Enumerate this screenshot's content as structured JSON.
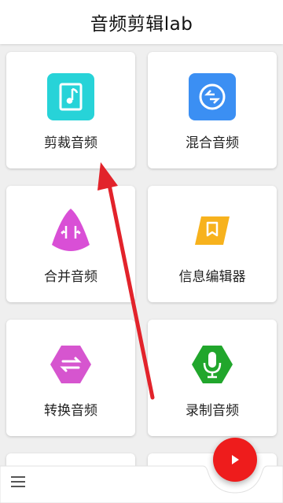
{
  "header": {
    "title": "音频剪辑lab"
  },
  "cards": [
    {
      "label": "剪裁音频",
      "icon": "music-file-icon",
      "color": "#27d3d8"
    },
    {
      "label": "混合音频",
      "icon": "mix-cycle-icon",
      "color": "#3b8ff3"
    },
    {
      "label": "合并音频",
      "icon": "merge-icon",
      "color": "#d94fd6"
    },
    {
      "label": "信息编辑器",
      "icon": "bookmark-icon",
      "color": "#f7b21d"
    },
    {
      "label": "转换音频",
      "icon": "convert-icon",
      "color": "#d655cf"
    },
    {
      "label": "录制音频",
      "icon": "microphone-icon",
      "color": "#21a62c"
    }
  ],
  "bottom_bar": {
    "menu_icon": "hamburger-menu-icon",
    "fab_icon": "play-icon",
    "fab_color": "#ee1c1c"
  },
  "annotation": {
    "arrow_color": "#e2232b"
  }
}
